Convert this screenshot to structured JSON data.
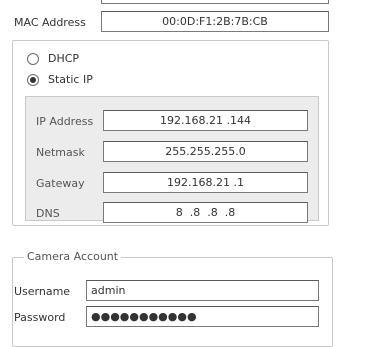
{
  "network": {
    "mac_label": "MAC Address",
    "mac_value": "00:0D:F1:2B:7B:CB",
    "mode_options": [
      {
        "label": "DHCP",
        "selected": false
      },
      {
        "label": "Static IP",
        "selected": true
      }
    ],
    "static": {
      "ip_label": "IP Address",
      "ip_value": "192.168.21 .144",
      "netmask_label": "Netmask",
      "netmask_value": "255.255.255.0",
      "gateway_label": "Gateway",
      "gateway_value": "192.168.21 .1",
      "dns_label": "DNS",
      "dns_value": "8  .8  .8  .8"
    }
  },
  "camera_account": {
    "legend": "Camera Account",
    "username_label": "Username",
    "username_value": "admin",
    "password_label": "Password",
    "password_mask": "●●●●●●●●●●●"
  }
}
